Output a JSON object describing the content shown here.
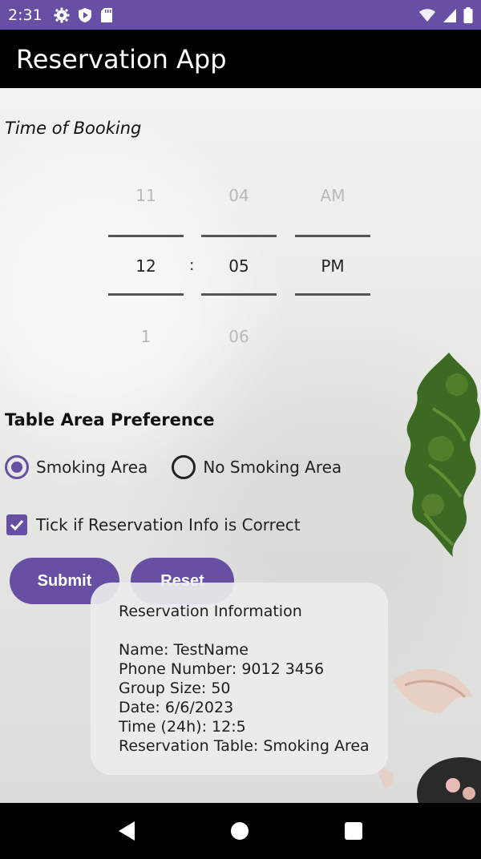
{
  "status_bar": {
    "time": "2:31",
    "icons_left": [
      "gear-icon",
      "shield-play-icon",
      "sd-card-icon"
    ],
    "icons_right": [
      "wifi-off-icon",
      "signal-icon",
      "battery-icon"
    ],
    "color": "#6750a4"
  },
  "app_bar": {
    "title": "Reservation App"
  },
  "booking": {
    "label": "Time of Booking"
  },
  "time_picker": {
    "hour": {
      "prev": "11",
      "selected": "12",
      "next": "1"
    },
    "minute": {
      "prev": "04",
      "selected": "05",
      "next": "06"
    },
    "ampm": {
      "prev": "AM",
      "selected": "PM"
    },
    "separator": ":"
  },
  "table_area": {
    "title": "Table Area Preference",
    "options": [
      {
        "label": "Smoking Area",
        "checked": true
      },
      {
        "label": "No Smoking Area",
        "checked": false
      }
    ]
  },
  "confirm": {
    "label": "Tick if Reservation Info is Correct",
    "checked": true
  },
  "buttons": {
    "submit": "Submit",
    "reset": "Reset"
  },
  "toast": {
    "title": "Reservation Information",
    "lines": [
      "Name: TestName",
      "Phone Number: 9012 3456",
      "Group Size: 50",
      "Date: 6/6/2023",
      "Time (24h): 12:5",
      "Reservation Table: Smoking Area"
    ]
  },
  "colors": {
    "accent": "#6750a4"
  }
}
